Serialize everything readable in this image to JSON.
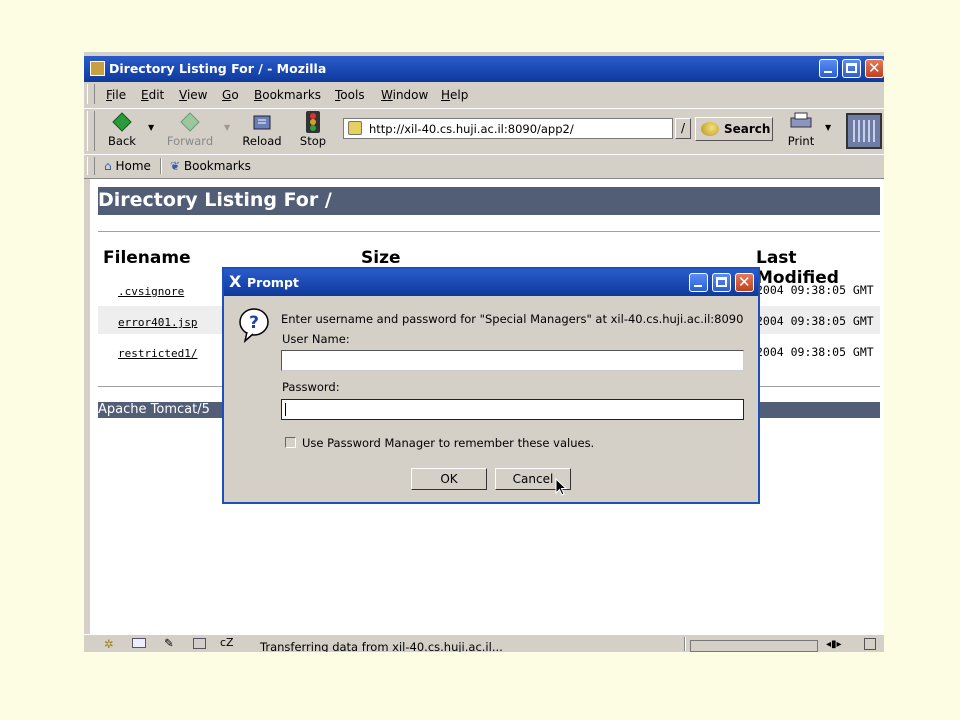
{
  "window": {
    "title": "Directory Listing For / - Mozilla"
  },
  "menu": [
    "File",
    "Edit",
    "View",
    "Go",
    "Bookmarks",
    "Tools",
    "Window",
    "Help"
  ],
  "nav": {
    "back": "Back",
    "forward": "Forward",
    "reload": "Reload",
    "stop": "Stop",
    "url": "http://xil-40.cs.huji.ac.il:8090/app2/",
    "go": "/",
    "search": "Search",
    "print": "Print"
  },
  "bookmarks": {
    "home": "Home",
    "bookmarks": "Bookmarks"
  },
  "page": {
    "heading": "Directory Listing For /",
    "col_filename": "Filename",
    "col_size": "Size",
    "col_modified": "Last Modified",
    "rows": [
      {
        "name": ".cvsignore",
        "modified": "2004 09:38:05 GMT"
      },
      {
        "name": "error401.jsp",
        "modified": "2004 09:38:05 GMT"
      },
      {
        "name": "restricted1/",
        "modified": "2004 09:38:05 GMT"
      }
    ],
    "footer": "Apache Tomcat/5"
  },
  "status": {
    "text": "Transferring data from xil-40.cs.huji.ac.il..."
  },
  "dialog": {
    "title": "Prompt",
    "message": "Enter username and password for \"Special Managers\" at xil-40.cs.huji.ac.il:8090",
    "username_label": "User Name:",
    "username_value": "",
    "password_label": "Password:",
    "password_value": "",
    "remember_label": "Use Password Manager to remember these values.",
    "remember_checked": false,
    "ok": "OK",
    "cancel": "Cancel"
  },
  "colors": {
    "titlebar": "#1847b0",
    "tomcat_header": "#525d76",
    "desktop": "#fdfde3"
  }
}
